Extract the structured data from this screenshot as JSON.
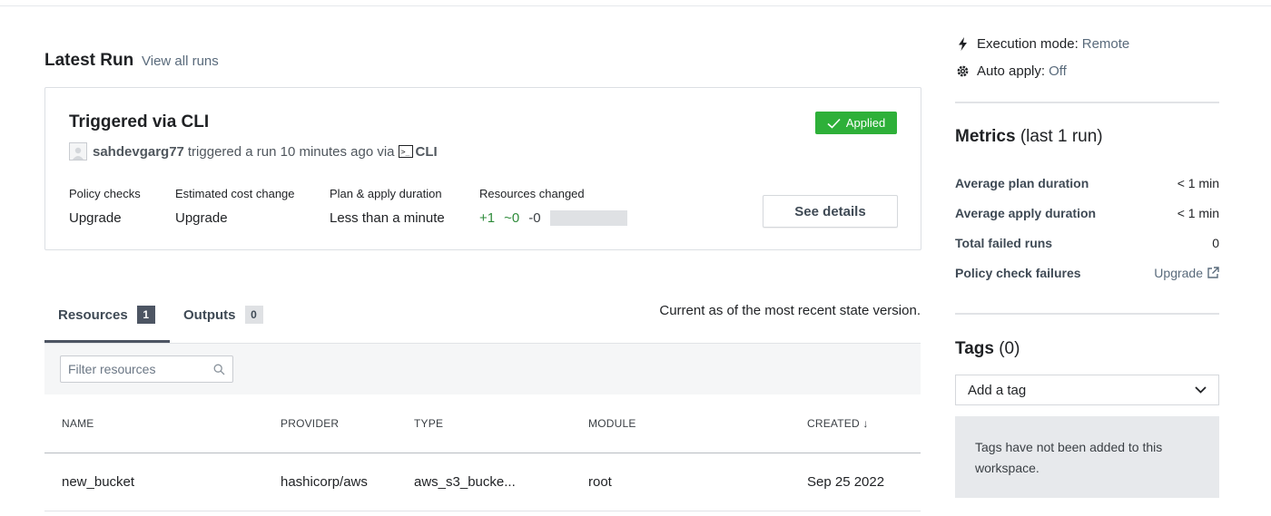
{
  "latest_run": {
    "title": "Latest Run",
    "view_all": "View all runs",
    "card": {
      "title": "Triggered via CLI",
      "status": "Applied",
      "user": "sahdevgarg77",
      "action_text": "triggered a run 10 minutes ago via",
      "source": "CLI",
      "stats": [
        {
          "label": "Policy checks",
          "value": "Upgrade"
        },
        {
          "label": "Estimated cost change",
          "value": "Upgrade"
        },
        {
          "label": "Plan & apply duration",
          "value": "Less than a minute"
        },
        {
          "label": "Resources changed",
          "value": ""
        }
      ],
      "resources_changed": {
        "added": "+1",
        "changed": "~0",
        "destroyed": "-0"
      },
      "details_button": "See details"
    }
  },
  "tabs": [
    {
      "label": "Resources",
      "count": "1"
    },
    {
      "label": "Outputs",
      "count": "0"
    }
  ],
  "state_note": "Current as of the most recent state version.",
  "filter": {
    "placeholder": "Filter resources"
  },
  "table": {
    "headers": [
      "NAME",
      "PROVIDER",
      "TYPE",
      "MODULE",
      "CREATED ↓"
    ],
    "rows": [
      [
        "new_bucket",
        "hashicorp/aws",
        "aws_s3_bucke...",
        "root",
        "Sep 25 2022"
      ]
    ]
  },
  "sidebar": {
    "execution_mode": {
      "label": "Execution mode:",
      "value": "Remote"
    },
    "auto_apply": {
      "label": "Auto apply:",
      "value": "Off"
    },
    "metrics": {
      "title": "Metrics",
      "subtitle": "(last 1 run)",
      "rows": [
        {
          "label": "Average plan duration",
          "value": "< 1 min"
        },
        {
          "label": "Average apply duration",
          "value": "< 1 min"
        },
        {
          "label": "Total failed runs",
          "value": "0"
        },
        {
          "label": "Policy check failures",
          "value": "Upgrade"
        }
      ]
    },
    "tags": {
      "title": "Tags",
      "count": "(0)",
      "select_label": "Add a tag",
      "empty_text": "Tags have not been added to this workspace."
    }
  },
  "colors": {
    "applied_badge": "#2eb039",
    "link": "#5a6b7c",
    "added": "#2e8b3a"
  }
}
